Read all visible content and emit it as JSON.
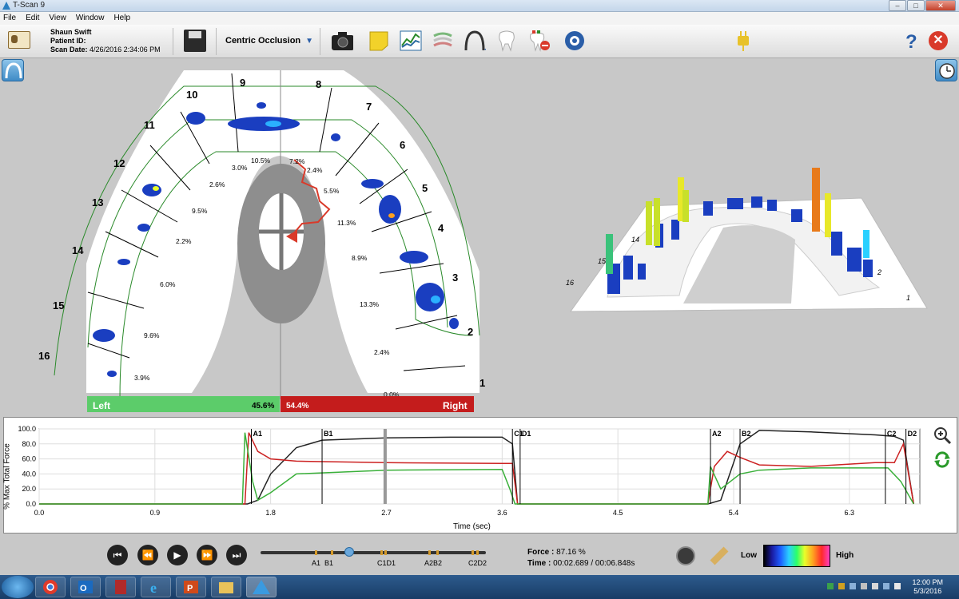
{
  "window": {
    "title": "T-Scan 9",
    "buttons": [
      "–",
      "□",
      "✕"
    ]
  },
  "menu": [
    "File",
    "Edit",
    "View",
    "Window",
    "Help"
  ],
  "patient": {
    "name": "Shaun Swift",
    "id_label": "Patient ID:",
    "id_value": "",
    "scan_label": "Scan Date:",
    "scan_value": "4/26/2016 2:34:06 PM"
  },
  "toolbar": {
    "occlusion": "Centric Occlusion",
    "dropdown_arrow": "▼",
    "help": "?",
    "close": "✕"
  },
  "icons": [
    "patient-card-icon",
    "save-icon",
    "camera-icon",
    "note-icon",
    "graph-icon",
    "layers-icon",
    "arch-icon",
    "tooth-icon",
    "tooth-record-icon",
    "support-icon",
    "plug-icon",
    "help-icon",
    "close-icon",
    "arch-view-icon",
    "clock-icon"
  ],
  "arch": {
    "tooth_numbers": [
      {
        "n": "1"
      },
      {
        "n": "2"
      },
      {
        "n": "3"
      },
      {
        "n": "4"
      },
      {
        "n": "5"
      },
      {
        "n": "6"
      },
      {
        "n": "7"
      },
      {
        "n": "8"
      },
      {
        "n": "9"
      },
      {
        "n": "10"
      },
      {
        "n": "11"
      },
      {
        "n": "12"
      },
      {
        "n": "13"
      },
      {
        "n": "14"
      },
      {
        "n": "15"
      },
      {
        "n": "16"
      }
    ],
    "percentages": [
      "10.5%",
      "7.2%",
      "2.4%",
      "5.5%",
      "11.3%",
      "8.9%",
      "13.3%",
      "2.4%",
      "3.0%",
      "2.6%",
      "9.5%",
      "2.2%",
      "6.0%",
      "9.6%",
      "3.9%",
      "0.0%"
    ],
    "left_label": "Left",
    "left_pct": "45.6%",
    "right_label": "Right",
    "right_pct": "54.4%"
  },
  "view3d_labels": [
    "15",
    "16",
    "14",
    "2",
    "1"
  ],
  "graph": {
    "ylabel": "% Max Total Force",
    "xlabel": "Time (sec)",
    "yticks": [
      "100.0",
      "80.0",
      "60.0",
      "40.0",
      "20.0",
      "0.0"
    ],
    "xticks": [
      "0.0",
      "0.9",
      "1.8",
      "2.7",
      "3.6",
      "4.5",
      "5.4",
      "6.3"
    ],
    "markers": [
      "A1",
      "B1",
      "C1",
      "D1",
      "A2",
      "B2",
      "C2",
      "D2"
    ]
  },
  "chart_data": {
    "type": "line",
    "title": "",
    "xlabel": "Time (sec)",
    "ylabel": "% Max Total Force",
    "xlim": [
      0,
      6.848
    ],
    "ylim": [
      0,
      100
    ],
    "series": [
      {
        "color": "#222222",
        "x": [
          0,
          1.62,
          1.7,
          1.8,
          2.0,
          2.2,
          2.7,
          3.2,
          3.6,
          3.68,
          3.72,
          3.8,
          5.2,
          5.3,
          5.45,
          5.6,
          6.0,
          6.5,
          6.65,
          6.72,
          6.8
        ],
        "y": [
          0,
          0,
          5,
          40,
          75,
          85,
          88,
          89,
          89,
          80,
          0,
          0,
          0,
          5,
          80,
          98,
          96,
          92,
          90,
          85,
          0
        ]
      },
      {
        "color": "#cc2222",
        "x": [
          0,
          1.6,
          1.63,
          1.7,
          1.8,
          2.0,
          2.7,
          3.6,
          3.68,
          3.72,
          3.8,
          5.2,
          5.25,
          5.35,
          5.45,
          5.6,
          6.0,
          6.5,
          6.65,
          6.72,
          6.8
        ],
        "y": [
          0,
          0,
          95,
          70,
          60,
          57,
          55,
          54,
          54,
          0,
          0,
          0,
          50,
          70,
          62,
          52,
          50,
          55,
          55,
          80,
          0
        ]
      },
      {
        "color": "#3ab03a",
        "x": [
          0,
          1.58,
          1.6,
          1.66,
          1.7,
          1.8,
          2.0,
          2.7,
          3.6,
          3.66,
          3.7,
          3.8,
          5.2,
          5.22,
          5.3,
          5.45,
          5.6,
          6.0,
          6.6,
          6.7,
          6.8
        ],
        "y": [
          0,
          0,
          95,
          30,
          5,
          15,
          40,
          45,
          46,
          20,
          0,
          0,
          0,
          50,
          20,
          40,
          45,
          48,
          48,
          30,
          0
        ]
      }
    ],
    "markers": [
      {
        "label": "A1",
        "x": 1.65
      },
      {
        "label": "B1",
        "x": 2.2
      },
      {
        "label": "C1",
        "x": 3.68
      },
      {
        "label": "D1",
        "x": 3.74
      },
      {
        "label": "A2",
        "x": 5.22
      },
      {
        "label": "B2",
        "x": 5.45
      },
      {
        "label": "C2",
        "x": 6.58
      },
      {
        "label": "D2",
        "x": 6.74
      }
    ],
    "cursor_x": 2.69
  },
  "playback": {
    "buttons": [
      "⏮",
      "⏪",
      "▶",
      "⏩",
      "⏭"
    ],
    "timeline_labels": [
      "A1",
      "B1",
      "C1D1",
      "A2B2",
      "C2D2"
    ],
    "position": 0.393
  },
  "readout": {
    "force_label": "Force :",
    "force_value": "87.16 %",
    "time_label": "Time :",
    "time_value": "00:02.689 / 00:06.848s"
  },
  "legend": {
    "low": "Low",
    "high": "High"
  },
  "clock": {
    "time": "12:00 PM",
    "date": "5/3/2016"
  }
}
